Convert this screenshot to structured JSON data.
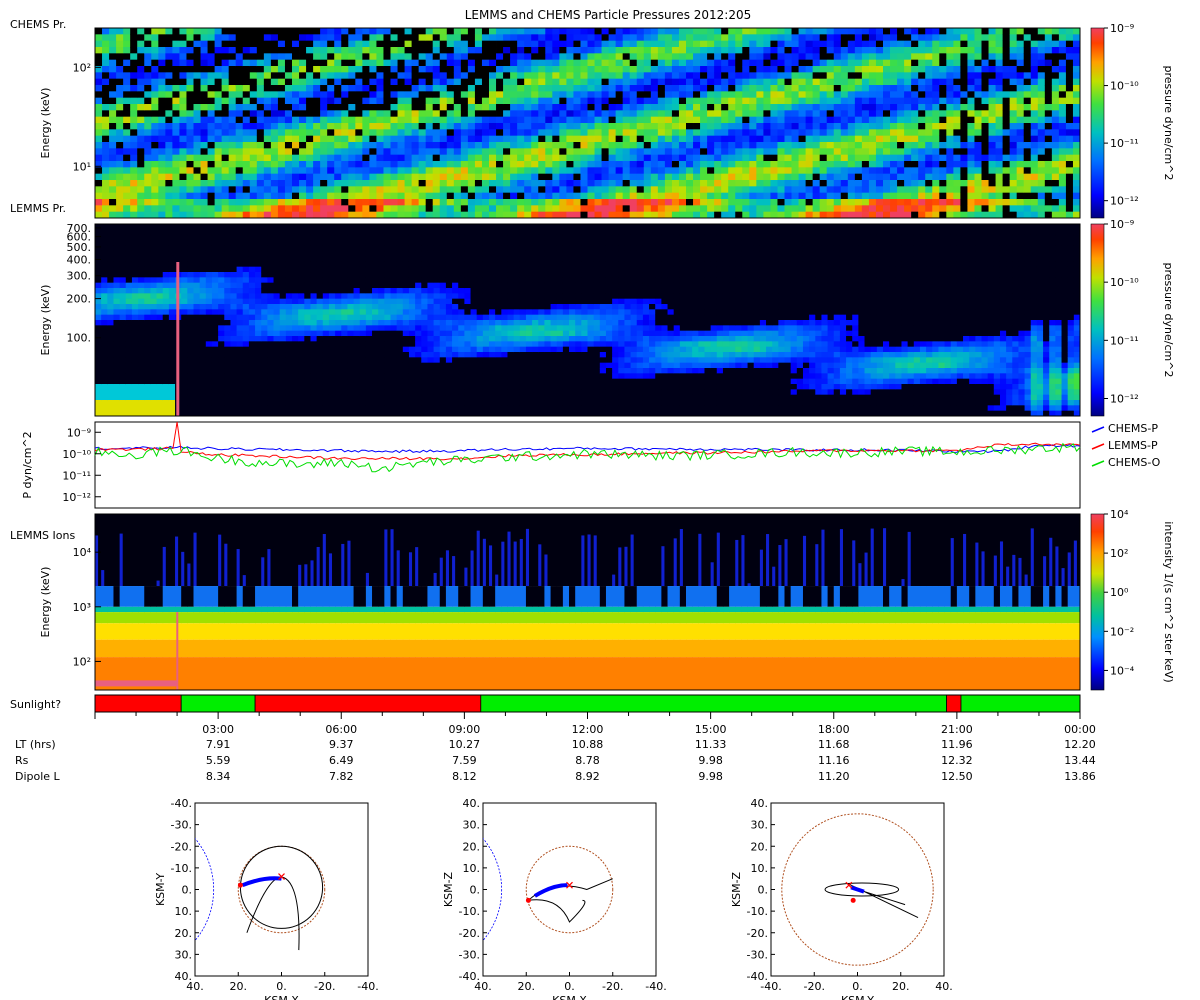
{
  "title": "LEMMS and CHEMS Particle Pressures  2012:205",
  "colors": {
    "sun_yes": "#00ee00",
    "sun_no": "#ff0000",
    "chems_p": "#0000ff",
    "lemms_p": "#ff0000",
    "chems_o": "#00dd00",
    "dipole": "#0000ff",
    "boundary": "#b05020"
  },
  "chart_data": [
    {
      "type": "heatmap",
      "panel_label": "CHEMS Pr.",
      "ylabel": "Energy (keV)",
      "yscale": "log",
      "ylim": [
        3,
        250
      ],
      "y_ticks": [
        {
          "value": 10,
          "label": "10¹"
        },
        {
          "value": 100,
          "label": "10²"
        }
      ],
      "colorbar": {
        "label": "pressure dyne/cm^2",
        "scale": "log",
        "range": [
          5e-13,
          1e-09
        ],
        "ticks": [
          {
            "value": 1e-09,
            "label": "10⁻⁹"
          },
          {
            "value": 1e-10,
            "label": "10⁻¹⁰"
          },
          {
            "value": 1e-11,
            "label": "10⁻¹¹"
          },
          {
            "value": 1e-12,
            "label": "10⁻¹²"
          }
        ]
      }
    },
    {
      "type": "heatmap",
      "panel_label": "LEMMS Pr.",
      "ylabel": "Energy (keV)",
      "yscale": "log",
      "ylim": [
        25,
        750
      ],
      "y_ticks": [
        {
          "value": 100,
          "label": "100."
        },
        {
          "value": 200,
          "label": "200."
        },
        {
          "value": 300,
          "label": "300."
        },
        {
          "value": 400,
          "label": "400."
        },
        {
          "value": 500,
          "label": "500."
        },
        {
          "value": 600,
          "label": "600."
        },
        {
          "value": 700,
          "label": "700."
        }
      ],
      "colorbar": {
        "label": "pressure dyne/cm^2",
        "scale": "log",
        "range": [
          5e-13,
          1e-09
        ],
        "ticks": [
          {
            "value": 1e-09,
            "label": "10⁻⁹"
          },
          {
            "value": 1e-10,
            "label": "10⁻¹⁰"
          },
          {
            "value": 1e-11,
            "label": "10⁻¹¹"
          },
          {
            "value": 1e-12,
            "label": "10⁻¹²"
          }
        ]
      }
    },
    {
      "type": "line",
      "ylabel": "P dyn/cm^2",
      "yscale": "log",
      "ylim": [
        3e-13,
        3e-09
      ],
      "y_ticks": [
        {
          "value": 1e-09,
          "label": "10⁻⁹"
        },
        {
          "value": 1e-10,
          "label": "10⁻¹⁰"
        },
        {
          "value": 1e-11,
          "label": "10⁻¹¹"
        },
        {
          "value": 1e-12,
          "label": "10⁻¹²"
        }
      ],
      "x_unit": "hours",
      "series": [
        {
          "name": "CHEMS-P",
          "color": "#0000ff",
          "x": [
            0,
            1,
            2,
            3,
            4,
            5,
            6,
            7,
            8,
            9,
            10,
            11,
            12,
            13,
            14,
            15,
            16,
            17,
            18,
            19,
            20,
            21,
            22,
            23,
            24
          ],
          "y": [
            1.8e-10,
            1.8e-10,
            2e-10,
            1.7e-10,
            1.6e-10,
            1.5e-10,
            1.4e-10,
            1.3e-10,
            1.3e-10,
            1.4e-10,
            1.6e-10,
            1.7e-10,
            1.8e-10,
            1.7e-10,
            1.7e-10,
            1.6e-10,
            1.6e-10,
            1.5e-10,
            1.5e-10,
            1.5e-10,
            1.4e-10,
            1.3e-10,
            1.3e-10,
            2.5e-10,
            2.3e-10
          ]
        },
        {
          "name": "LEMMS-P",
          "color": "#ff0000",
          "x": [
            0,
            1,
            1.9,
            2.0,
            2.1,
            3,
            4,
            5,
            6,
            7,
            8,
            9,
            10,
            11,
            12,
            13,
            14,
            15,
            16,
            17,
            18,
            19,
            20,
            21,
            22,
            23,
            24
          ],
          "y": [
            1.6e-10,
            1.6e-10,
            1.8e-10,
            3e-09,
            1.2e-10,
            9e-11,
            8e-11,
            7e-11,
            6e-11,
            6e-11,
            6e-11,
            6e-11,
            8e-11,
            9e-11,
            9e-11,
            1e-10,
            1.1e-10,
            1.1e-10,
            1.2e-10,
            1.3e-10,
            1.4e-10,
            1.4e-10,
            1.4e-10,
            1.4e-10,
            2.6e-10,
            2.8e-10,
            2.5e-10
          ]
        },
        {
          "name": "CHEMS-O",
          "color": "#00dd00",
          "x": [
            0,
            1,
            2,
            3,
            4,
            5,
            6,
            7,
            8,
            9,
            10,
            11,
            12,
            13,
            14,
            15,
            16,
            17,
            18,
            19,
            20,
            21,
            22,
            23,
            24
          ],
          "y": [
            1.2e-10,
            9e-11,
            1.5e-10,
            6e-11,
            4e-11,
            3e-11,
            4e-11,
            2e-11,
            4e-11,
            5e-11,
            7e-11,
            8e-11,
            1e-10,
            9e-11,
            8e-11,
            9e-11,
            1e-10,
            1.2e-10,
            1.1e-10,
            1.2e-10,
            1.3e-10,
            1.2e-10,
            1.4e-10,
            1.8e-10,
            2e-10
          ]
        }
      ]
    },
    {
      "type": "heatmap",
      "panel_label": "LEMMS Ions",
      "ylabel": "Energy (keV)",
      "yscale": "log",
      "ylim": [
        30,
        50000
      ],
      "y_ticks": [
        {
          "value": 100,
          "label": "10²"
        },
        {
          "value": 1000,
          "label": "10³"
        },
        {
          "value": 10000,
          "label": "10⁴"
        }
      ],
      "colorbar": {
        "label": "intensity 1/(s cm^2 ster keV)",
        "scale": "log",
        "range": [
          1e-05,
          10000.0
        ],
        "ticks": [
          {
            "value": 10000.0,
            "label": "10⁴"
          },
          {
            "value": 100.0,
            "label": "10²"
          },
          {
            "value": 1,
            "label": "10⁰"
          },
          {
            "value": 0.01,
            "label": "10⁻²"
          },
          {
            "value": 0.0001,
            "label": "10⁻⁴"
          }
        ]
      }
    }
  ],
  "sunlight": {
    "label": "Sunlight?",
    "segments": [
      {
        "start": 0.0,
        "end": 2.1,
        "sunlit": false
      },
      {
        "start": 2.1,
        "end": 3.9,
        "sunlit": true
      },
      {
        "start": 3.9,
        "end": 9.4,
        "sunlit": false
      },
      {
        "start": 9.4,
        "end": 20.75,
        "sunlit": true
      },
      {
        "start": 20.75,
        "end": 21.1,
        "sunlit": false
      },
      {
        "start": 21.1,
        "end": 24.0,
        "sunlit": true
      }
    ]
  },
  "time_axis": {
    "range_hours": [
      0,
      24
    ],
    "ticks": [
      {
        "hour": 3,
        "label": "03:00",
        "lt": "7.91",
        "rs": "5.59",
        "dipole_l": "8.34"
      },
      {
        "hour": 6,
        "label": "06:00",
        "lt": "9.37",
        "rs": "6.49",
        "dipole_l": "7.82"
      },
      {
        "hour": 9,
        "label": "09:00",
        "lt": "10.27",
        "rs": "7.59",
        "dipole_l": "8.12"
      },
      {
        "hour": 12,
        "label": "12:00",
        "lt": "10.88",
        "rs": "8.78",
        "dipole_l": "8.92"
      },
      {
        "hour": 15,
        "label": "15:00",
        "lt": "11.33",
        "rs": "9.98",
        "dipole_l": "9.98"
      },
      {
        "hour": 18,
        "label": "18:00",
        "lt": "11.68",
        "rs": "11.16",
        "dipole_l": "11.20"
      },
      {
        "hour": 21,
        "label": "21:00",
        "lt": "11.96",
        "rs": "12.32",
        "dipole_l": "12.50"
      },
      {
        "hour": 24,
        "label": "00:00",
        "lt": "12.20",
        "rs": "13.44",
        "dipole_l": "13.86"
      }
    ],
    "row_labels": {
      "lt": "LT (hrs)",
      "rs": "Rs",
      "dipole_l": "Dipole L"
    }
  },
  "orbit_plots": [
    {
      "xlabel": "KSM-X",
      "ylabel": "KSM-Y",
      "xlim": [
        40,
        -40
      ],
      "ylim": [
        -40,
        40
      ],
      "x_ticks": [
        "40.",
        "20.",
        "0.",
        "-20.",
        "-40."
      ],
      "y_ticks": [
        "-40.",
        "-30.",
        "-20.",
        "-10.",
        "0.",
        "10.",
        "20.",
        "30.",
        "40."
      ]
    },
    {
      "xlabel": "KSM-X",
      "ylabel": "KSM-Z",
      "xlim": [
        40,
        -40
      ],
      "ylim": [
        40,
        -40
      ],
      "x_ticks": [
        "40.",
        "20.",
        "0.",
        "-20.",
        "-40."
      ],
      "y_ticks": [
        "40.",
        "30.",
        "20.",
        "10.",
        "0.",
        "-10.",
        "-20.",
        "-30.",
        "-40."
      ]
    },
    {
      "xlabel": "KSM-Y",
      "ylabel": "KSM-Z",
      "xlim": [
        -40,
        40
      ],
      "ylim": [
        40,
        -40
      ],
      "x_ticks": [
        "-40.",
        "-20.",
        "0.",
        "20.",
        "40."
      ],
      "y_ticks": [
        "40.",
        "30.",
        "20.",
        "10.",
        "0.",
        "-10.",
        "-20.",
        "-30.",
        "-40."
      ]
    }
  ]
}
